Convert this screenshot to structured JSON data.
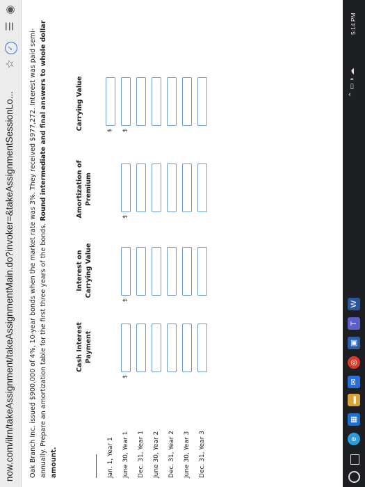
{
  "browser": {
    "url": "now.com/ilrn/takeAssignment/takeAssignmentMain.do?invoker=&takeAssignmentSessionLo..."
  },
  "problem": {
    "text": "Oak Branch Inc. issued $900,000 of 4%, 10-year bonds when the market rate was 3%. They received $977,272. Interest was paid semi-annually. Prepare an amortization table for the first three years of the bonds.",
    "instruction": "Round intermediate and final answers to whole dollar amount."
  },
  "table": {
    "headers": [
      "Cash Interest Payment",
      "Interest on Carrying Value",
      "Amortization of Premium",
      "Carrying Value"
    ],
    "rows": [
      "Jan. 1, Year 1",
      "June 30, Year 1",
      "Dec. 31, Year 1",
      "June 30, Year 2",
      "Dec. 31, Year 2",
      "June 30, Year 3",
      "Dec. 31, Year 3"
    ],
    "currency_symbol": "$"
  },
  "taskbar": {
    "clock": "5:14 PM"
  },
  "icons": [
    "star-icon",
    "extension-icon",
    "reading-list-icon",
    "profile-icon",
    "start-icon",
    "task-view-icon",
    "edge-icon",
    "store-icon",
    "file-explorer-icon",
    "mail-icon",
    "chrome-icon",
    "app-icon",
    "teams-icon",
    "word-icon"
  ],
  "colors": {
    "input_border": "#6a9ad0",
    "taskbar": "#1e1f23"
  }
}
